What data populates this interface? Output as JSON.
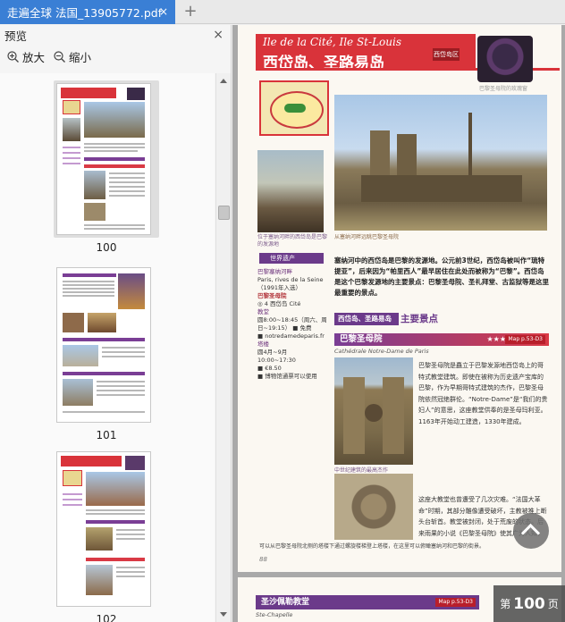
{
  "tab": {
    "title": "走遍全球 法国_13905772.pdf",
    "close": "×"
  },
  "newtab": "+",
  "sidebar": {
    "title": "预览",
    "close": "×",
    "zoom_in": "放大",
    "zoom_out": "缩小",
    "pages": [
      {
        "num": "100"
      },
      {
        "num": "101"
      },
      {
        "num": "102"
      }
    ]
  },
  "doc": {
    "banner_en": "Ile de la Cité, Ile St-Louis",
    "banner_zh": "西岱岛、圣路易岛",
    "banner_tag": "西岱岛区",
    "rose_caption": "巴黎圣母院的玫瑰窗",
    "photo_caption": "从塞纳河畔远眺巴黎圣母院",
    "side_caption": "位于塞纳河畔的西岱岛是巴黎的发源地",
    "heritage_tag": "世界遗产",
    "side_info": [
      {
        "cls": "",
        "text": "巴黎塞纳河畔"
      },
      {
        "cls": "dark",
        "text": "Paris, rives de la Seine"
      },
      {
        "cls": "dark",
        "text": "（1991年入选）"
      },
      {
        "cls": "blk",
        "text": "巴黎圣母院"
      },
      {
        "cls": "dark",
        "text": "◎ 4 西岱岛 Cité"
      },
      {
        "cls": "",
        "text": "教堂"
      },
      {
        "cls": "dark",
        "text": "圆8:00~18:45（周六、周日~19:15） ■ 免费"
      },
      {
        "cls": "dark",
        "text": "■ notredamedeparis.fr"
      },
      {
        "cls": "",
        "text": "塔楼"
      },
      {
        "cls": "dark",
        "text": "圆4月~9月 10:00~17:30"
      },
      {
        "cls": "dark",
        "text": "■ €8.50"
      },
      {
        "cls": "dark",
        "text": "■ 博物馆通票可以使用"
      }
    ],
    "intro": "塞纳河中的西岱岛是巴黎的发源地。公元前3世纪，西岱岛被叫作“琉特提亚”，后来因为“帕里西人”最早居住在此处而被称为“巴黎”。西岱岛是这个巴黎发源地的主要景点：巴黎圣母院、圣礼拜堂、古监狱等是这里最重要的景点。",
    "section_label": "西岱岛、圣路易岛",
    "section_title": "主要景点",
    "sight_title": "巴黎圣母院",
    "sight_stars": "★★★",
    "sight_map": "Map p.53-D3",
    "sight_sub": "Cathédrale Notre-Dame de Paris",
    "nd2_caption": "中世纪建筑的最高杰作",
    "body1": "巴黎圣母院是矗立于巴黎发源地西岱岛上的哥特式教堂建筑。即使在被称为历史遗产宝库的巴黎，作为早期哥特式建筑的杰作，巴黎圣母院依然冠绝群伦。“Notre-Dame”是“我们的贵妇人”的意思，这座教堂供奉的是圣母玛利亚。1163年开始动工建造，1330年建成。",
    "body2": "这座大教堂也曾遭受了几次灾难。“法国大革命”时期，其部分雕像遭受破坏，主教被推上断头台斩首。教堂被封闭，处于荒废的状态。后来雨果的小说《巴黎圣母院》使其广为人知，又开始了教堂的修复工程。1864年修复工程结束之后，巴黎圣母院恢复了昔日的光辉。",
    "foot_note": "可以从巴黎圣母院北侧的塔楼下通过螺旋楼梯登上塔楼，在这里可以俯瞰塞纳河和巴黎的街景。",
    "page_number": "88",
    "page2_title": "圣沙佩勒教堂",
    "page2_map": "Map p.53-D3",
    "page2_sub": "Ste-Chapelle"
  },
  "page_indicator": {
    "prefix": "第",
    "num": "100",
    "suffix": "页"
  }
}
